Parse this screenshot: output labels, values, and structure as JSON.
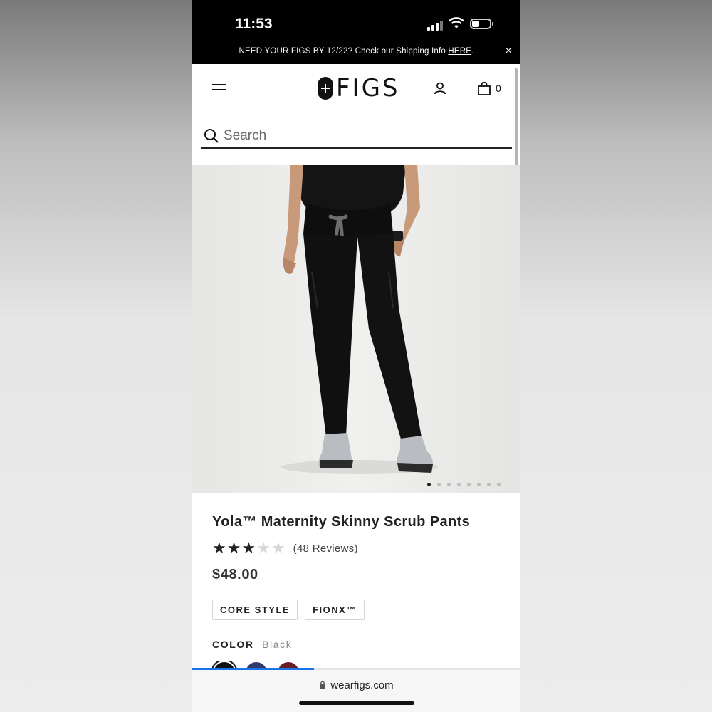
{
  "status_bar": {
    "time": "11:53",
    "battery_level": 0.3
  },
  "promo": {
    "text": "NEED YOUR FIGS BY 12/22? Check our Shipping Info ",
    "link": "HERE",
    "tail": ".",
    "close_icon": "×"
  },
  "header": {
    "logo": "FIGS",
    "cart_count": "0"
  },
  "search": {
    "placeholder": "Search"
  },
  "carousel": {
    "dots": 8,
    "active_index": 0
  },
  "product": {
    "title": "Yola™ Maternity Skinny Scrub Pants",
    "rating": 3,
    "rating_max": 5,
    "reviews_label": "48 Reviews",
    "price": "$48.00",
    "tags": [
      "CORE STYLE",
      "FIONX™"
    ],
    "color_label": "COLOR",
    "color_value": "Black",
    "swatch_colors": [
      "#111111",
      "#2f3c6d",
      "#6b1d24"
    ]
  },
  "page_load_progress": 0.37,
  "browser": {
    "url": "wearfigs.com"
  },
  "colors": {
    "accent": "#1a73e8",
    "banner": "#000000"
  }
}
